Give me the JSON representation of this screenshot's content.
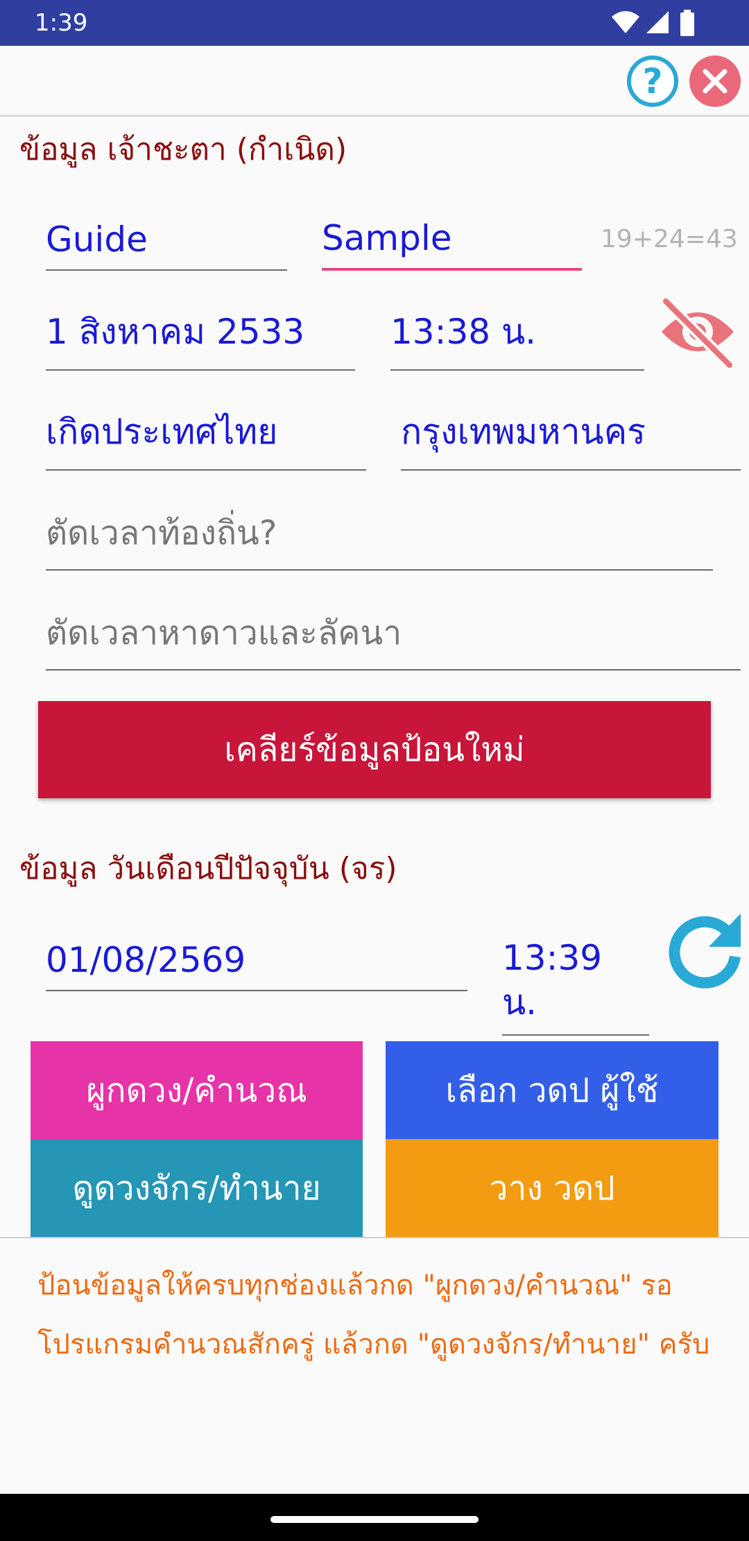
{
  "status": {
    "time": "1:39"
  },
  "birth_section": {
    "title": "ข้อมูล เจ้าชะตา (กำเนิด)",
    "first_name": "Guide",
    "last_name": "Sample",
    "name_calc": "19+24=43",
    "birth_date": "1 สิงหาคม 2533",
    "birth_time": "13:38 น.",
    "country": "เกิดประเทศไทย",
    "province": "กรุงเทพมหานคร",
    "local_time_hint": "ตัดเวลาท้องถิ่น?",
    "star_time_hint": "ตัดเวลาหาดาวและลัคนา",
    "clear_button": "เคลียร์ข้อมูลป้อนใหม่"
  },
  "current_section": {
    "title": "ข้อมูล วันเดือนปีปัจจุบัน (จร)",
    "date": "01/08/2569",
    "time": "13:39 น."
  },
  "actions": {
    "calculate": "ผูกดวง/คำนวณ",
    "choose_chart": "เลือก วดป ผู้ใช้",
    "view_chart": "ดูดวงจักร/ทำนาย",
    "place_chart": "วาง วดป"
  },
  "instructions": "ป้อนข้อมูลให้ครบทุกช่องแล้วกด \"ผูกดวง/คำนวณ\" รอโปรแกรมคำนวณสักครู่ แล้วกด \"ดูดวงจักร/ทำนาย\" ครับ",
  "icons": {
    "help": "help-icon",
    "close": "close-icon",
    "visibility_off": "visibility-off-icon",
    "refresh": "refresh-icon"
  },
  "colors": {
    "status_bar": "#303f9f",
    "title": "#8b0e0e",
    "input_text": "#1a1ad6",
    "clear": "#c8153a",
    "calculate": "#e733a8",
    "choose": "#335fe8",
    "view": "#2596b5",
    "place": "#f39c12",
    "instructions": "#ef6a12"
  }
}
